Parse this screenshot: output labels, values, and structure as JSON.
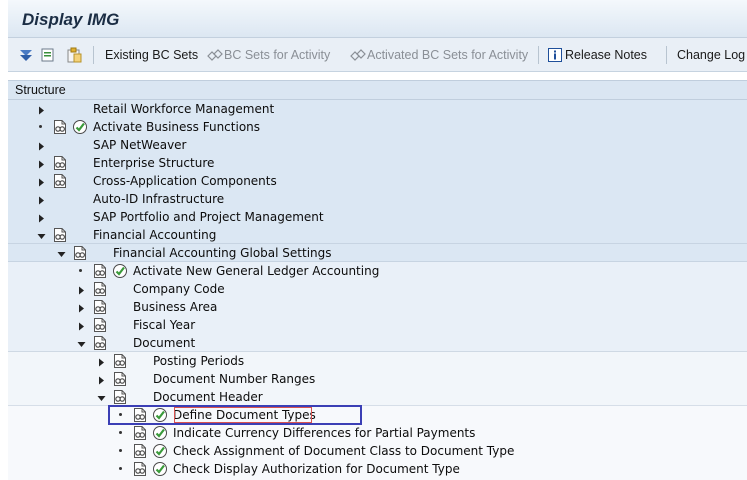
{
  "window": {
    "title": "Display IMG"
  },
  "toolbar": {
    "existing_bc_sets": "Existing BC Sets",
    "bc_sets_for_activity": "BC Sets for Activity",
    "activated_bc_sets_for_activity": "Activated BC Sets for Activity",
    "release_notes": "Release Notes",
    "change_log": "Change Log"
  },
  "structure": {
    "header": "Structure"
  },
  "tree": {
    "items": [
      {
        "label": "Retail Workforce Management",
        "expander": "collapsed",
        "doc": false,
        "check": false
      },
      {
        "label": "Activate Business Functions",
        "expander": "leaf",
        "doc": true,
        "check": true
      },
      {
        "label": "SAP NetWeaver",
        "expander": "collapsed",
        "doc": false,
        "check": false
      },
      {
        "label": "Enterprise Structure",
        "expander": "collapsed",
        "doc": true,
        "check": false
      },
      {
        "label": "Cross-Application Components",
        "expander": "collapsed",
        "doc": true,
        "check": false
      },
      {
        "label": "Auto-ID Infrastructure",
        "expander": "collapsed",
        "doc": false,
        "check": false
      },
      {
        "label": "SAP Portfolio and Project Management",
        "expander": "collapsed",
        "doc": false,
        "check": false
      },
      {
        "label": "Financial Accounting",
        "expander": "expanded",
        "doc": true,
        "check": false
      },
      {
        "label": "Financial Accounting Global Settings",
        "expander": "expanded",
        "doc": true,
        "check": false
      },
      {
        "label": "Activate New General Ledger Accounting",
        "expander": "leaf",
        "doc": true,
        "check": true
      },
      {
        "label": "Company Code",
        "expander": "collapsed",
        "doc": true,
        "check": false
      },
      {
        "label": "Business Area",
        "expander": "collapsed",
        "doc": true,
        "check": false
      },
      {
        "label": "Fiscal Year",
        "expander": "collapsed",
        "doc": true,
        "check": false
      },
      {
        "label": "Document",
        "expander": "expanded",
        "doc": true,
        "check": false
      },
      {
        "label": "Posting Periods",
        "expander": "collapsed",
        "doc": true,
        "check": false
      },
      {
        "label": "Document Number Ranges",
        "expander": "collapsed",
        "doc": true,
        "check": false
      },
      {
        "label": "Document Header",
        "expander": "expanded",
        "doc": true,
        "check": false
      },
      {
        "label": "Define Document Types",
        "expander": "leaf",
        "doc": true,
        "check": true,
        "selected": true
      },
      {
        "label": "Indicate Currency Differences for Partial Payments",
        "expander": "leaf",
        "doc": true,
        "check": true
      },
      {
        "label": "Check Assignment of Document Class to Document Type",
        "expander": "leaf",
        "doc": true,
        "check": true
      },
      {
        "label": "Check Display Authorization for Document Type",
        "expander": "leaf",
        "doc": true,
        "check": true
      }
    ]
  },
  "colors": {
    "band_level0": "#dbe7f3",
    "band_level1": "#e8f0f8",
    "band_level2": "#f3f7fb",
    "selection": "#3b3fb5",
    "check": "#3a9a3a"
  }
}
